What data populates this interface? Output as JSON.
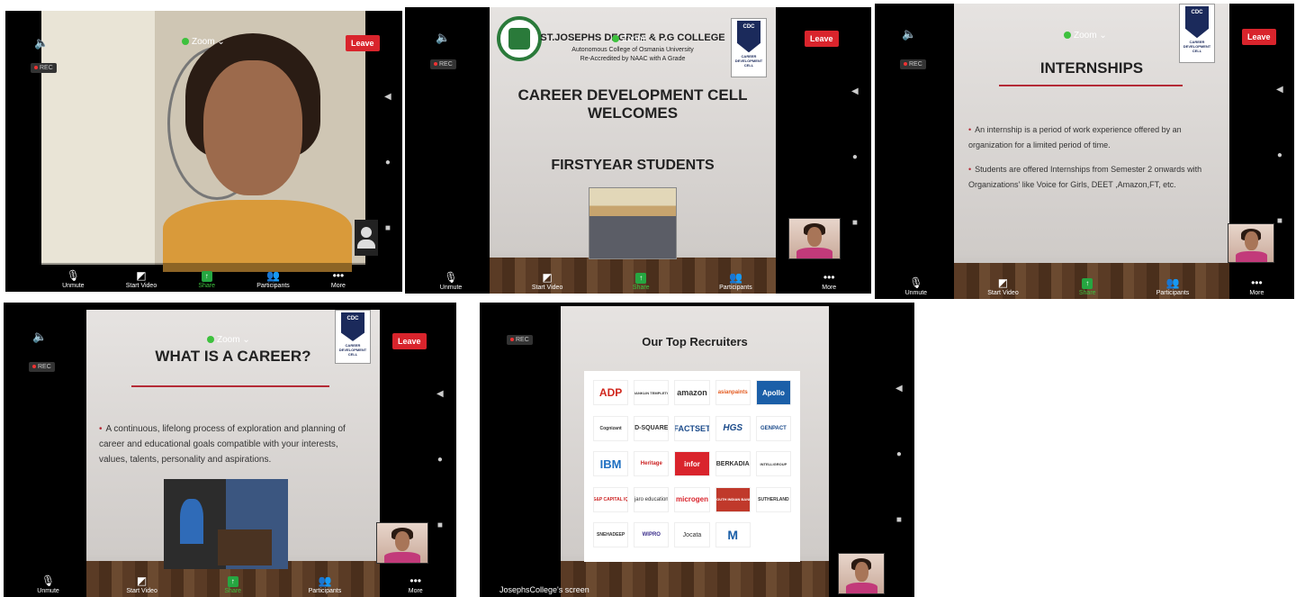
{
  "zoom": {
    "title": "Zoom",
    "leave": "Leave",
    "rec": "REC",
    "toolbar": {
      "unmute": "Unmute",
      "start_video": "Start Video",
      "share": "Share",
      "participants": "Participants",
      "more": "More"
    }
  },
  "slide2": {
    "college": "ST.JOSEPHS DEGREE & P.G COLLEGE",
    "sub1": "Autonomous College of Osmania University",
    "sub2": "Re-Accredited by NAAC with A Grade",
    "welcome1": "CAREER DEVELOPMENT CELL",
    "welcome2": "WELCOMES",
    "students": "FIRSTYEAR STUDENTS"
  },
  "slide3": {
    "title": "INTERNSHIPS",
    "bullets": [
      "An internship is a period of work experience offered by an organization for a limited period of time.",
      "Students are offered Internships from Semester 2 onwards with Organizations' like Voice for Girls, DEET ,Amazon,FT, etc."
    ]
  },
  "slide4": {
    "title": "WHAT IS A CAREER?",
    "bullets": [
      "A continuous, lifelong process of exploration and planning of career and educational goals compatible with your interests, values, talents, personality and aspirations."
    ]
  },
  "slide5": {
    "title": "Our Top Recruiters",
    "screen_label": "JosephsCollege's screen",
    "logos": [
      "ADP",
      "FRANKLIN TEMPLETON",
      "amazon",
      "asianpaints",
      "Apollo",
      "Cognizant",
      "D-SQUARE",
      "FACTSET",
      "HGS",
      "GENPACT",
      "IBM",
      "Heritage",
      "infor",
      "BERKADIA",
      "INTELLIGROUP",
      "S&P CAPITAL IQ",
      "jaro education",
      "microgen",
      "SOUTH INDIAN BANK",
      "SUTHERLAND",
      "SNEHADEEP",
      "WIPRO",
      "Jocata",
      "M",
      ""
    ]
  },
  "cdc": {
    "badge": "CDC",
    "text": "CAREER DEVELOPMENT CELL"
  }
}
